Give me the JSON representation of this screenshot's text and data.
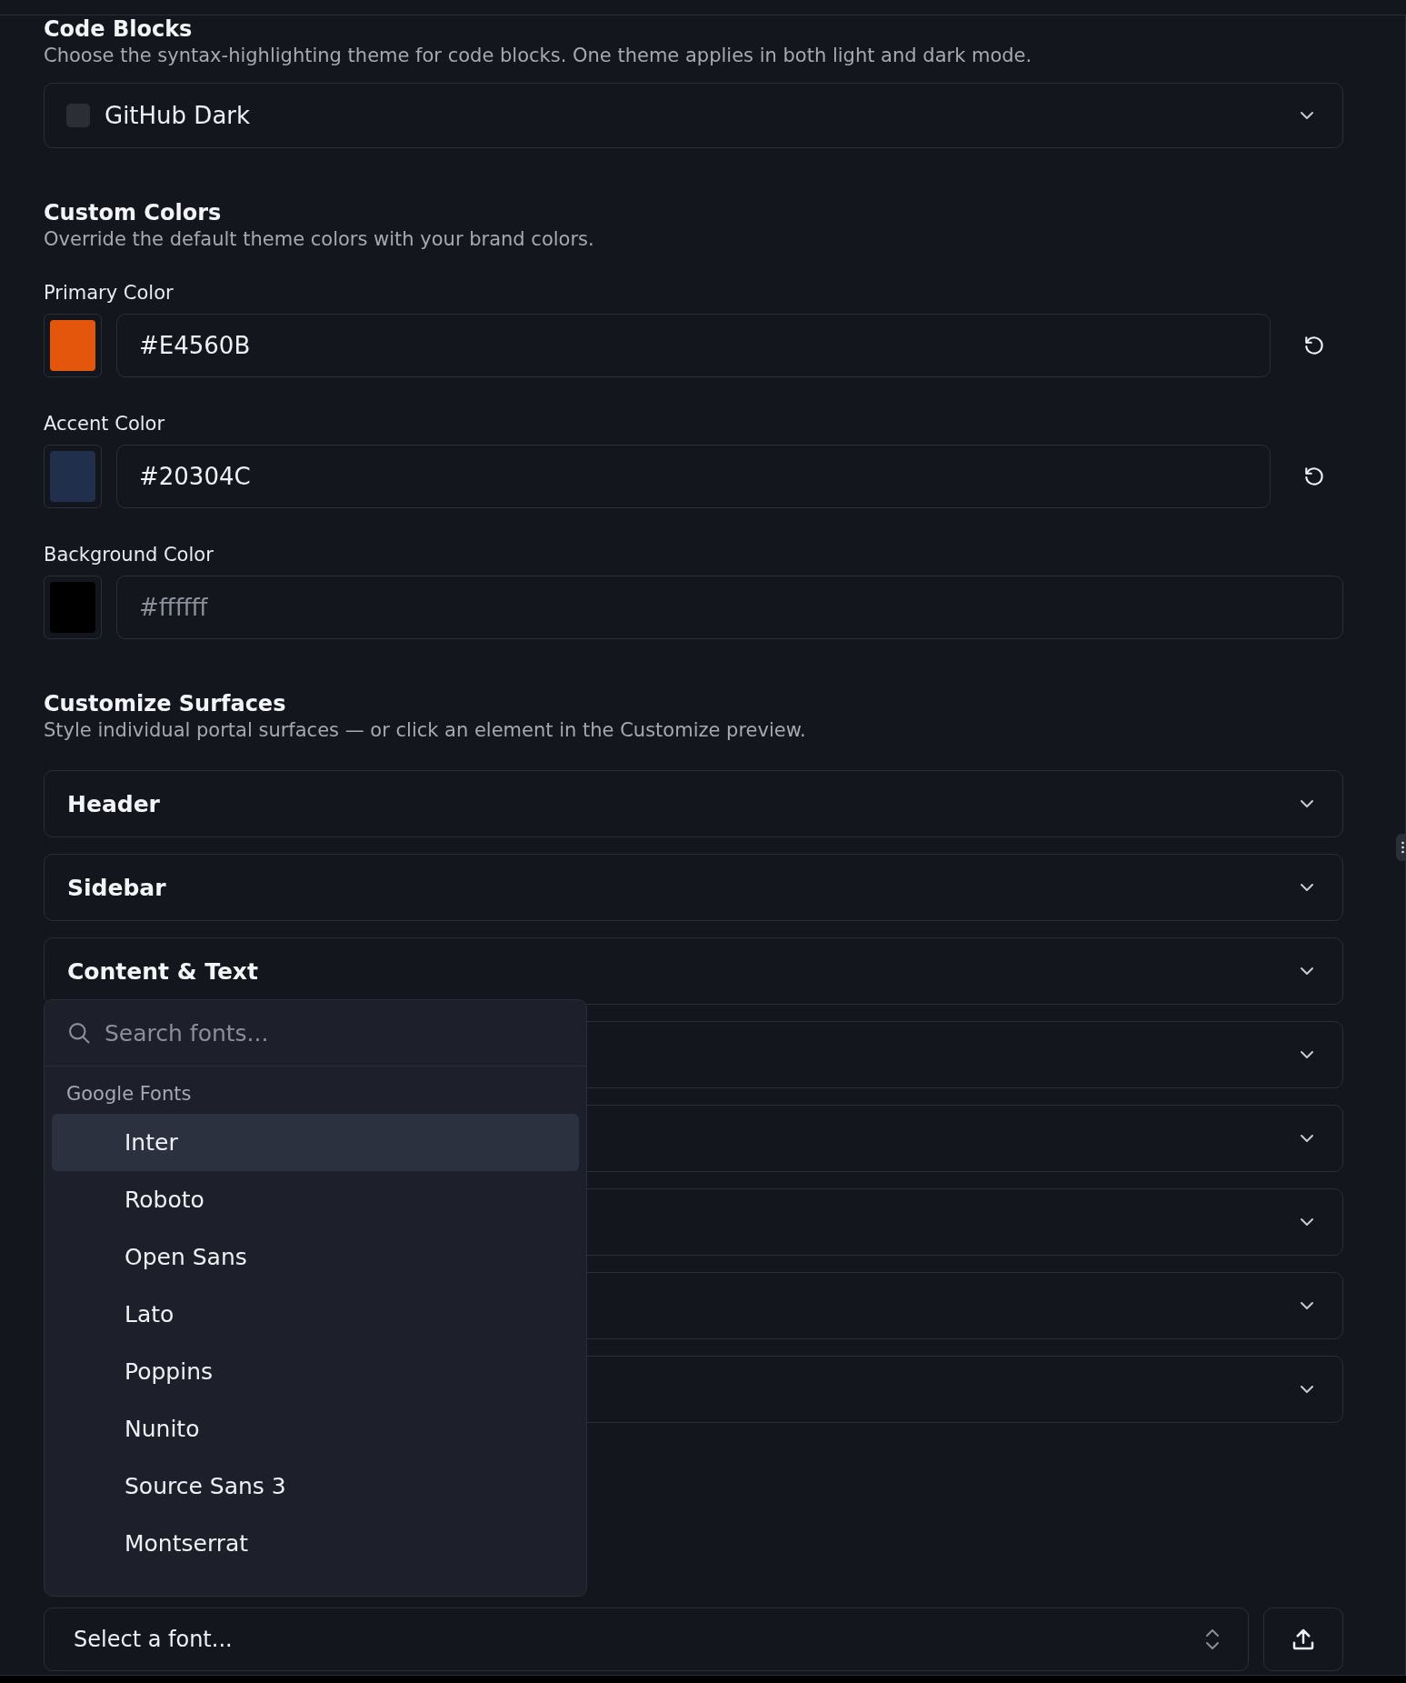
{
  "code_blocks": {
    "title": "Code Blocks",
    "description": "Choose the syntax-highlighting theme for code blocks. One theme applies in both light and dark mode.",
    "value": "GitHub Dark"
  },
  "custom_colors": {
    "title": "Custom Colors",
    "description": "Override the default theme colors with your brand colors.",
    "fields": [
      {
        "label": "Primary Color",
        "color": "#e4560b",
        "value": "#E4560B",
        "resettable": true
      },
      {
        "label": "Accent Color",
        "color": "#20304c",
        "value": "#20304C",
        "resettable": true
      },
      {
        "label": "Background Color",
        "color": "#000000",
        "placeholder": "#ffffff",
        "resettable": false
      }
    ]
  },
  "surfaces": {
    "title": "Customize Surfaces",
    "description": "Style individual portal surfaces — or click an element in the Customize preview.",
    "items": [
      {
        "label": "Header",
        "expanded": false
      },
      {
        "label": "Sidebar",
        "expanded": false
      },
      {
        "label": "Content & Text",
        "expanded": false
      },
      {
        "expanded": false
      },
      {
        "expanded": false
      },
      {
        "expanded": false
      },
      {
        "expanded": false
      },
      {
        "expanded": false
      }
    ]
  },
  "font_picker": {
    "search_placeholder": "Search fonts...",
    "group": "Google Fonts",
    "options": [
      {
        "label": "Inter",
        "selected": true
      },
      {
        "label": "Roboto",
        "selected": false
      },
      {
        "label": "Open Sans",
        "selected": false
      },
      {
        "label": "Lato",
        "selected": false
      },
      {
        "label": "Poppins",
        "selected": false
      },
      {
        "label": "Nunito",
        "selected": false
      },
      {
        "label": "Source Sans 3",
        "selected": false
      },
      {
        "label": "Montserrat",
        "selected": false
      }
    ],
    "select_placeholder": "Select a font..."
  }
}
